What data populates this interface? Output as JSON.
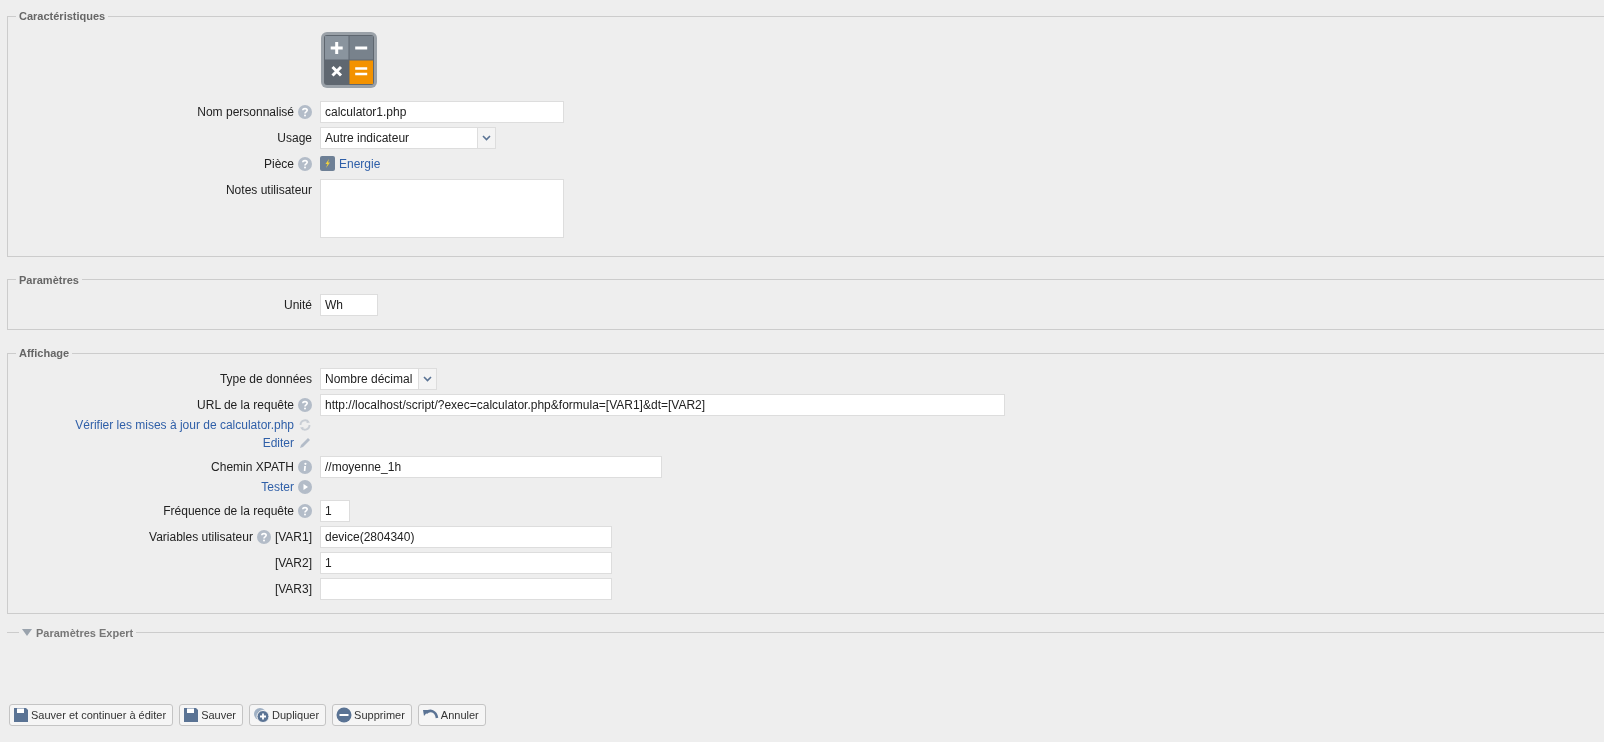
{
  "sections": [
    {
      "title": "Caractéristiques",
      "rows": [
        {
          "kind": "icon"
        },
        {
          "kind": "text",
          "label": "Nom personnalisé",
          "value": "calculator1.php"
        },
        {
          "kind": "select",
          "label": "Usage",
          "value": "Autre indicateur"
        },
        {
          "kind": "link",
          "label": "Pièce",
          "value": "Energie"
        },
        {
          "kind": "textarea",
          "label": "Notes utilisateur"
        }
      ]
    },
    {
      "title": "Paramètres",
      "rows": [
        {
          "kind": "text",
          "label": "Unité",
          "value": "Wh"
        }
      ]
    },
    {
      "title": "Affichage",
      "rows": [
        {
          "kind": "select",
          "label": "Type de données",
          "value": "Nombre décimal"
        },
        {
          "kind": "text",
          "label": "URL de la requête",
          "value": "http://localhost/script/?exec=calculator.php&formula=[VAR1]&dt=[VAR2]",
          "links": [
            "Vérifier les mises à jour de calculator.php",
            "Editer"
          ]
        },
        {
          "kind": "text",
          "label": "Chemin XPATH",
          "value": "//moyenne_1h",
          "links": [
            "Tester"
          ]
        },
        {
          "kind": "text",
          "label": "Fréquence de la requête",
          "value": "1"
        },
        {
          "kind": "text",
          "label": "Variables utilisateur",
          "tag": "[VAR1]",
          "value": "device(2804340)"
        },
        {
          "kind": "text",
          "tag": "[VAR2]",
          "value": "1"
        },
        {
          "kind": "text",
          "tag": "[VAR3]"
        }
      ]
    }
  ],
  "expert": {
    "title": "Paramètres Expert",
    "expanded": false
  },
  "buttons": [
    "Sauver et continuer à éditer",
    "Sauver",
    "Dupliquer",
    "Supprimer",
    "Annuler"
  ]
}
